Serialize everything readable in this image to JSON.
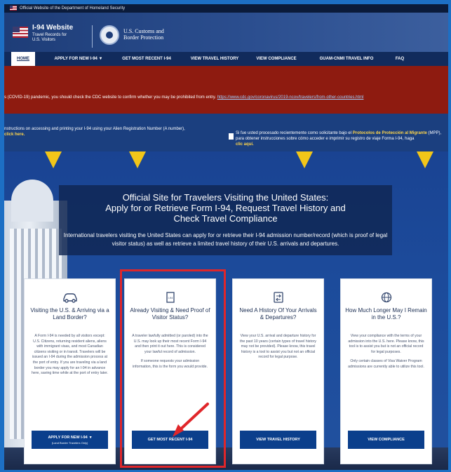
{
  "topbar": {
    "text": "Official Website of the Department of Homeland Security"
  },
  "header": {
    "site_title": "I-94 Website",
    "site_subtitle": "Travel Records for U.S. Visitors",
    "agency_line1": "U.S. Customs and",
    "agency_line2": "Border Protection"
  },
  "nav": {
    "items": [
      {
        "label": "HOME"
      },
      {
        "label": "APPLY FOR NEW I-94 ▼"
      },
      {
        "label": "GET MOST RECENT I-94"
      },
      {
        "label": "VIEW TRAVEL HISTORY"
      },
      {
        "label": "VIEW COMPLIANCE"
      },
      {
        "label": "GUAM-CNMI TRAVEL INFO"
      },
      {
        "label": "FAQ"
      }
    ]
  },
  "alert_covid": {
    "text": "s (COVID-19) pandemic, you should check the CDC website to confirm whether you may be prohibited from entry.",
    "link": "https://www.cdc.gov/coronavirus/2019-ncov/travelers/from-other-countries.html"
  },
  "alert_mpp": {
    "left_text": "nstructions on accessing and printing your I-94 using your Alien Registration Number (A number),",
    "left_link": "click here.",
    "right_pre": "Si fue usted procesado recientemente como solicitante bajo el ",
    "right_bold": "Protocolos de Protección al Migrante",
    "right_post": "(MPP), para obtener instrucciones sobre cómo acceder e imprimir su registro de viaje Forma I-94, haga",
    "right_link": "clic aquí."
  },
  "hero": {
    "title_line1": "Official Site for Travelers Visiting the United States:",
    "title_line2": "Apply for or Retrieve Form I-94, Request Travel History and",
    "title_line3": "Check Travel Compliance",
    "desc": "International travelers visiting the United States can apply for or retrieve their I-94 admission number/record (which is proof of legal visitor status) as well as retrieve a limited travel history of their U.S. arrivals and departures."
  },
  "cards": [
    {
      "icon": "car-icon",
      "title": "Visiting the U.S. & Arriving via a Land Border?",
      "body1": "A Form I-94 is needed by all visitors except: U.S. Citizens, returning resident aliens, aliens with immigrant visas, and most Canadian citizens visiting or in transit. Travelers will be issued an I-94 during the admission process at the port of entry. If you are traveling via a land border you may apply for an I-94 in advance here, saving time while at the port of entry later.",
      "button": "APPLY FOR NEW I-94",
      "button_sub": "(Land Border Travelers Only)"
    },
    {
      "icon": "document-icon",
      "title": "Already Visiting & Need Proof of Visitor Status?",
      "body1": "A traveler lawfully admitted (or paroled) into the U.S. may look up their most recent Form I-94 and then print it out here. This is considered your lawful record of admission.",
      "body2": "If someone requests your admission information, this is the form you would provide.",
      "button": "GET MOST RECENT I-94"
    },
    {
      "icon": "exchange-icon",
      "title": "Need A History Of Your Arrivals & Departures?",
      "body1": "View your U.S. arrival and departure history for the past 10 years (certain types of travel history may not be provided). Please know, this travel history is a tool to assist you but not an official record for legal purpose.",
      "button": "VIEW TRAVEL HISTORY"
    },
    {
      "icon": "globe-icon",
      "title": "How Much Longer May I Remain in the U.S.?",
      "body1": "View your compliance with the terms of your admission into the U.S. here. Please know, this tool is to assist you but is not an official record for legal purposes.",
      "body2": "Only certain classes of Visa Waiver Program admissions are currently able to utilize this tool.",
      "button": "VIEW COMPLIANCE"
    }
  ],
  "colors": {
    "nav_bg": "#112b5c",
    "alert_red": "#8e1b10",
    "button_blue": "#0b3f8c",
    "highlight_red": "#e0262a",
    "star_gold": "#f2c619"
  }
}
